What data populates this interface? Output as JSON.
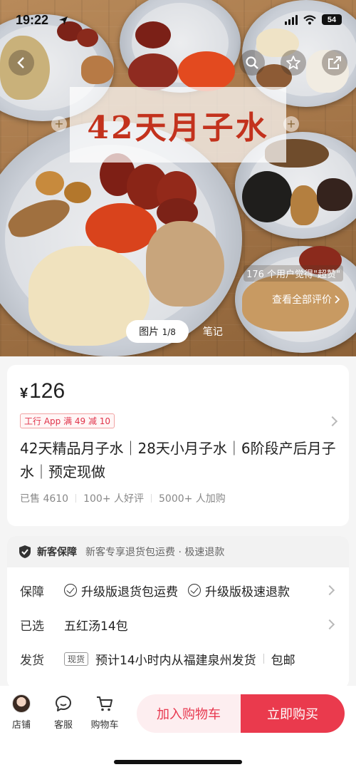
{
  "status_bar": {
    "time": "19:22",
    "battery": "54"
  },
  "hero": {
    "banner_title": "42天月子水",
    "review_hint": "176 个用户觉得\"超赞\"",
    "review_link": "查看全部评价",
    "pager_label": "图片",
    "pager_count": "1/8",
    "notes_tab": "笔记"
  },
  "product": {
    "price_symbol": "¥",
    "price": "126",
    "coupon": "工行 App 满 49 减 10",
    "title": "42天精品月子水｜28天小月子水｜6阶段产后月子水｜预定现做",
    "stats": [
      "已售 4610",
      "100+ 人好评",
      "5000+ 人加购"
    ]
  },
  "guarantee": {
    "header_title": "新客保障",
    "header_sub": "新客专享退货包运费 · 极速退款",
    "rows": [
      {
        "label": "保障",
        "items": [
          "升级版退货包运费",
          "升级版极速退款"
        ]
      },
      {
        "label": "已选",
        "value": "五红汤14包"
      },
      {
        "label": "发货",
        "tag": "现货",
        "value": "预计14小时内从福建泉州发货",
        "extra": "包邮"
      }
    ]
  },
  "bottom_bar": {
    "tabs": [
      "店铺",
      "客服",
      "购物车"
    ],
    "add_to_cart": "加入购物车",
    "buy_now": "立即购买"
  },
  "colors": {
    "accent": "#ea3a4d",
    "accent_light": "#fdeef0",
    "banner_text": "#c3321d"
  }
}
